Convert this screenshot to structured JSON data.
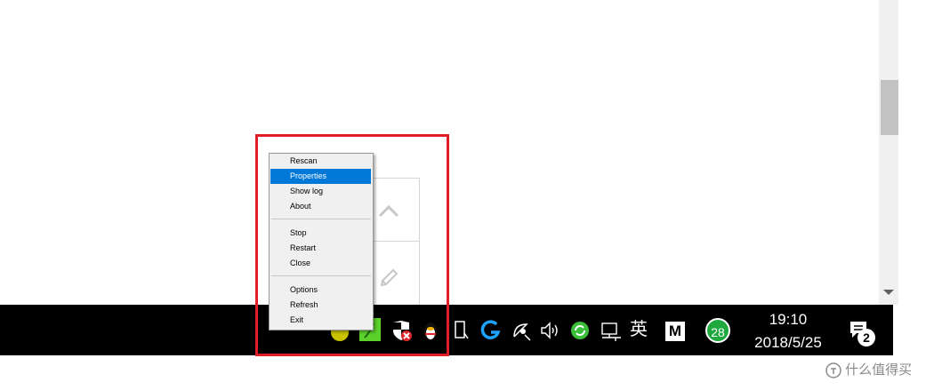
{
  "context_menu": {
    "items": [
      {
        "label": "Rescan"
      },
      {
        "label": "Properties"
      },
      {
        "label": "Show log"
      },
      {
        "label": "About"
      },
      {
        "label": "Stop"
      },
      {
        "label": "Restart"
      },
      {
        "label": "Close"
      },
      {
        "label": "Options"
      },
      {
        "label": "Refresh"
      },
      {
        "label": "Exit"
      }
    ],
    "selected": "Properties"
  },
  "taskbar": {
    "tray_icons": [
      "yellow-app-icon",
      "green-phone-icon",
      "shield-error-icon",
      "penguin-icon",
      "usb-device-icon",
      "logitech-g-icon",
      "network-satellite-icon",
      "volume-icon",
      "sync-icon",
      "ethernet-icon",
      "ime-icon",
      "m-box-icon",
      "badge-icon"
    ],
    "ime_label": "英",
    "m_label": "M",
    "badge_count": "28",
    "clock_time": "19:10",
    "clock_date": "2018/5/25",
    "notification_count": "2"
  },
  "watermark": {
    "text": "什么值得买"
  },
  "colors": {
    "highlight": "#e01e26",
    "selection": "#0078d7",
    "taskbar": "#000000"
  }
}
